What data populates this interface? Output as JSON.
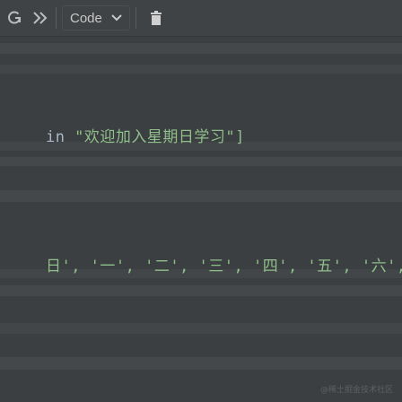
{
  "toolbar": {
    "restart_icon": "restart-kernel-icon",
    "run_icon": "fast-forward-run-icon",
    "cell_type_label": "Code",
    "dropdown_icon": "chevron-down-icon",
    "delete_icon": "trash-icon"
  },
  "code": {
    "line1_prefix": "in ",
    "line1_string": "\"欢迎加入星期日学习\"]",
    "line2_string": "日', '一', '二', '三', '四', '五', '六',"
  },
  "footer": {
    "watermark": "@稀土掘金技术社区"
  },
  "colors": {
    "background": "#3c3f41",
    "toolbar": "#404345",
    "text": "#cfcfcf"
  }
}
